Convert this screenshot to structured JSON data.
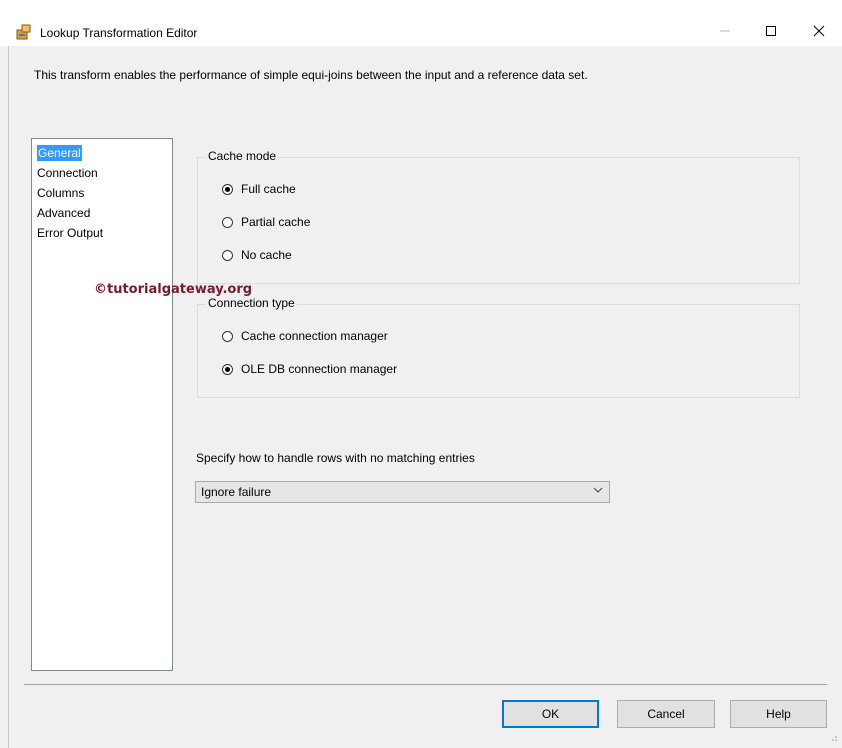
{
  "window": {
    "title": "Lookup Transformation Editor",
    "icon": "package-transform-icon"
  },
  "description": "This transform enables the performance of simple equi-joins between the input and a reference data set.",
  "nav": {
    "items": [
      {
        "label": "General",
        "selected": true
      },
      {
        "label": "Connection",
        "selected": false
      },
      {
        "label": "Columns",
        "selected": false
      },
      {
        "label": "Advanced",
        "selected": false
      },
      {
        "label": "Error Output",
        "selected": false
      }
    ]
  },
  "cache_mode": {
    "label": "Cache mode",
    "options": [
      {
        "label": "Full cache",
        "checked": true
      },
      {
        "label": "Partial cache",
        "checked": false
      },
      {
        "label": "No cache",
        "checked": false
      }
    ]
  },
  "connection_type": {
    "label": "Connection type",
    "options": [
      {
        "label": "Cache connection manager",
        "checked": false
      },
      {
        "label": "OLE DB connection manager",
        "checked": true
      }
    ]
  },
  "watermark": "©tutorialgateway.org",
  "no_match": {
    "label": "Specify how to handle rows with no matching entries",
    "selected": "Ignore failure"
  },
  "buttons": {
    "ok": "OK",
    "cancel": "Cancel",
    "help": "Help"
  },
  "colors": {
    "selection": "#3399ff",
    "accent_border": "#0078d7",
    "watermark": "#7a1a2a"
  }
}
